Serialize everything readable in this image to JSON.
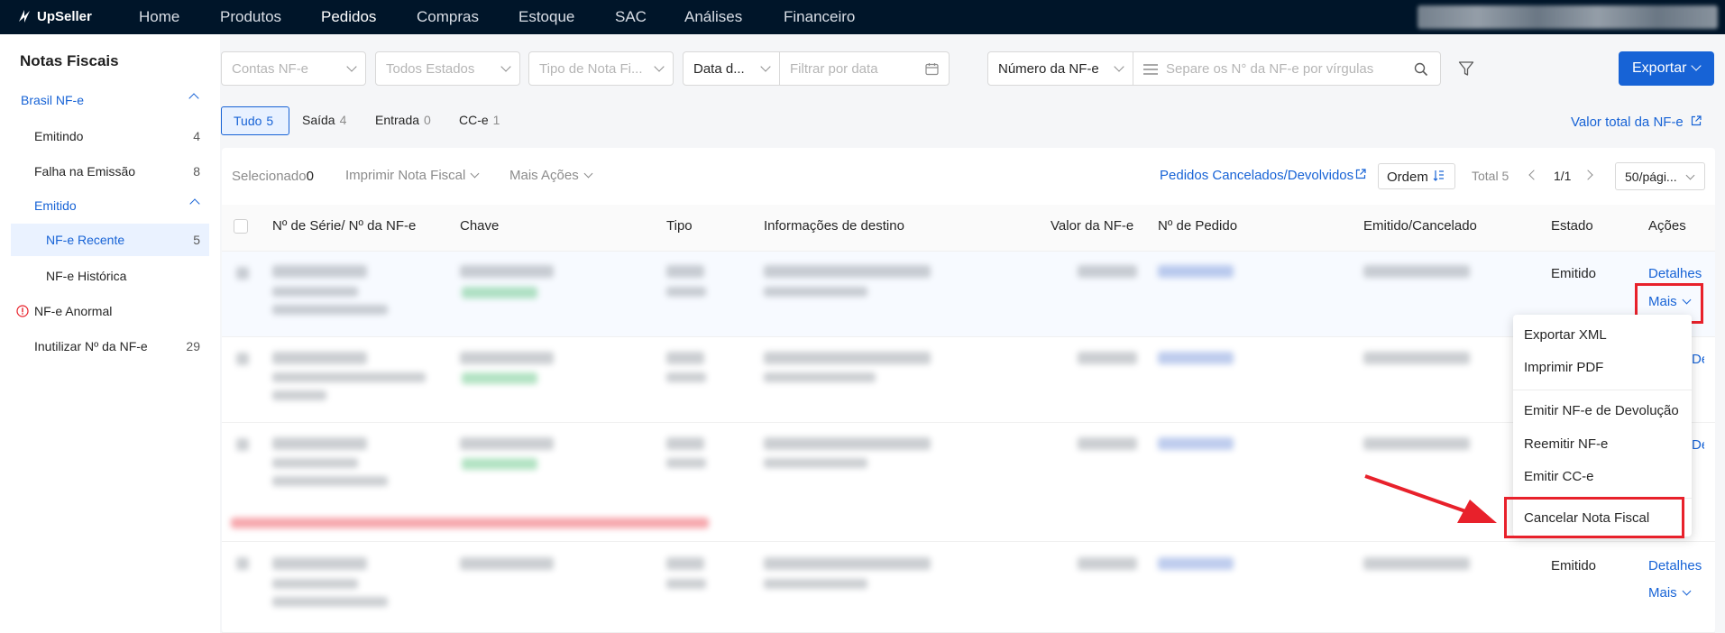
{
  "app": {
    "name": "UpSeller"
  },
  "nav": {
    "items": [
      "Home",
      "Produtos",
      "Pedidos",
      "Compras",
      "Estoque",
      "SAC",
      "Análises",
      "Financeiro"
    ],
    "active": "Pedidos"
  },
  "sidebar": {
    "title": "Notas Fiscais",
    "items": [
      {
        "label": "Brasil NF-e",
        "count": ""
      },
      {
        "label": "Emitindo",
        "count": "4"
      },
      {
        "label": "Falha na Emissão",
        "count": "8"
      },
      {
        "label": "Emitido",
        "count": ""
      },
      {
        "label": "NF-e Recente",
        "count": "5"
      },
      {
        "label": "NF-e Histórica",
        "count": ""
      },
      {
        "label": "NF-e Anormal",
        "count": ""
      },
      {
        "label": "Inutilizar Nº da NF-e",
        "count": "29"
      }
    ]
  },
  "filters": {
    "contas": "Contas NF-e",
    "estados": "Todos Estados",
    "tipo": "Tipo de Nota Fi...",
    "data_type": "Data d...",
    "data_placeholder": "Filtrar por data",
    "numero_type": "Número da NF-e",
    "numero_placeholder": "Separe os N° da NF-e por vírgulas",
    "export_label": "Exportar"
  },
  "tabs": [
    {
      "label": "Tudo",
      "count": "5"
    },
    {
      "label": "Saída",
      "count": "4"
    },
    {
      "label": "Entrada",
      "count": "0"
    },
    {
      "label": "CC-e",
      "count": "1"
    }
  ],
  "valor_total_link": "Valor total da NF-e",
  "toolbar": {
    "selecionado_label": "Selecionado",
    "selecionado_count": "0",
    "imprimir": "Imprimir Nota Fiscal",
    "mais_acoes": "Mais Ações",
    "pedidos_link": "Pedidos Cancelados/Devolvidos",
    "ordem": "Ordem",
    "total": "Total 5",
    "page": "1/1",
    "page_size": "50/pági..."
  },
  "table": {
    "columns": [
      "Nº de Série/ Nº da NF-e",
      "Chave",
      "Tipo",
      "Informações de destino",
      "Valor da NF-e",
      "Nº de Pedido",
      "Emitido/Cancelado",
      "Estado",
      "Ações"
    ],
    "rows": [
      {
        "estado": "Emitido",
        "detalhes": "Detalhes",
        "mais": "Mais"
      },
      {
        "estado": "",
        "detalhes": "Detalhes",
        "mais": ""
      },
      {
        "estado": "",
        "detalhes": "Detalhes",
        "mais": ""
      },
      {
        "estado": "Emitido",
        "detalhes": "Detalhes",
        "mais": "Mais"
      }
    ]
  },
  "dropdown": {
    "items": [
      "Exportar XML",
      "Imprimir PDF",
      "Emitir NF-e de Devolução",
      "Reemitir NF-e",
      "Emitir CC-e",
      "Cancelar Nota Fiscal"
    ]
  },
  "colors": {
    "accent": "#1763d6",
    "topbar": "#001529",
    "highlight": "#e8212b"
  }
}
